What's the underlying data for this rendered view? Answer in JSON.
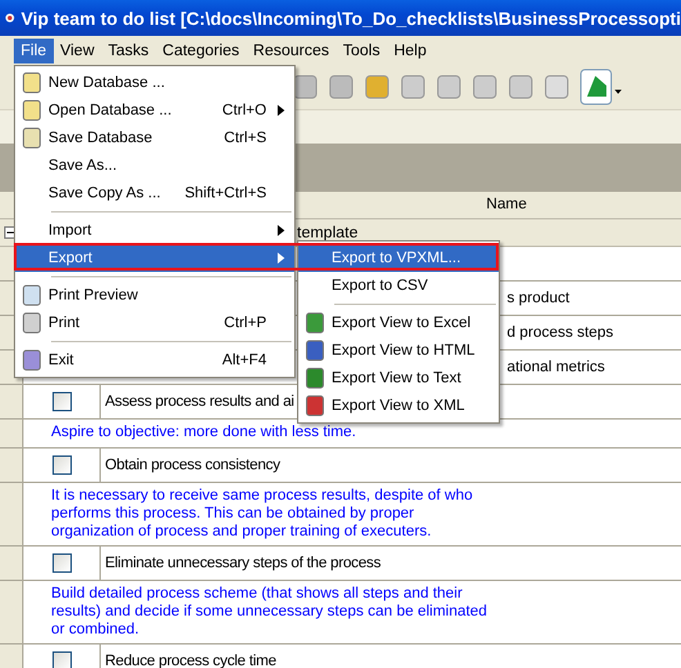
{
  "window": {
    "title": "Vip team to do list [C:\\docs\\Incoming\\To_Do_checklists\\BusinessProcessopti"
  },
  "menu_bar": [
    {
      "label": "File",
      "selected": true
    },
    {
      "label": "View",
      "selected": false
    },
    {
      "label": "Tasks",
      "selected": false
    },
    {
      "label": "Categories",
      "selected": false
    },
    {
      "label": "Resources",
      "selected": false
    },
    {
      "label": "Tools",
      "selected": false
    },
    {
      "label": "Help",
      "selected": false
    }
  ],
  "table": {
    "columns": [
      "Name"
    ],
    "group": {
      "label": "template",
      "expanded": true
    },
    "rows": [
      {
        "kind": "partial",
        "text": ""
      },
      {
        "kind": "partial",
        "text": "s product"
      },
      {
        "kind": "partial",
        "text": "d process steps"
      },
      {
        "kind": "partial",
        "text": "ational metrics"
      },
      {
        "kind": "task",
        "text": "Assess process results and ai",
        "checked": false
      },
      {
        "kind": "note",
        "text": "Aspire to objective: more done with less time."
      },
      {
        "kind": "task",
        "text": "Obtain process consistency",
        "checked": false
      },
      {
        "kind": "note",
        "text": "It is necessary to receive same process results, despite of who performs this process. This can be obtained by proper organization of process and proper training of executers."
      },
      {
        "kind": "task",
        "text": "Eliminate unnecessary steps of the process",
        "checked": false
      },
      {
        "kind": "note",
        "text": "Build detailed process scheme (that shows all steps and their results) and decide if some unnecessary steps can be eliminated or combined."
      },
      {
        "kind": "task",
        "text": "Reduce process cycle time",
        "checked": false
      }
    ]
  },
  "file_menu": [
    {
      "kind": "item",
      "label": "New Database ...",
      "selected": false
    },
    {
      "kind": "item",
      "label": "Open Database ...",
      "shortcut": "Ctrl+O",
      "submenu": true,
      "selected": false
    },
    {
      "kind": "item",
      "label": "Save Database",
      "shortcut": "Ctrl+S",
      "selected": false
    },
    {
      "kind": "item",
      "label": "Save As...",
      "selected": false
    },
    {
      "kind": "item",
      "label": "Save Copy As ...",
      "shortcut": "Shift+Ctrl+S",
      "selected": false
    },
    {
      "kind": "separator"
    },
    {
      "kind": "item",
      "label": "Import",
      "submenu": true,
      "selected": false
    },
    {
      "kind": "item",
      "label": "Export",
      "submenu": true,
      "selected": true
    },
    {
      "kind": "separator"
    },
    {
      "kind": "item",
      "label": "Print Preview",
      "selected": false
    },
    {
      "kind": "item",
      "label": "Print",
      "shortcut": "Ctrl+P",
      "selected": false
    },
    {
      "kind": "separator"
    },
    {
      "kind": "item",
      "label": "Exit",
      "shortcut": "Alt+F4",
      "selected": false
    }
  ],
  "export_submenu": [
    {
      "kind": "item",
      "label": "Export to VPXML...",
      "selected": true
    },
    {
      "kind": "item",
      "label": "Export to CSV",
      "selected": false
    },
    {
      "kind": "separator"
    },
    {
      "kind": "item",
      "label": "Export View to Excel",
      "selected": false
    },
    {
      "kind": "item",
      "label": "Export View to HTML",
      "selected": false
    },
    {
      "kind": "item",
      "label": "Export View to Text",
      "selected": false
    },
    {
      "kind": "item",
      "label": "Export View to XML",
      "selected": false
    }
  ]
}
